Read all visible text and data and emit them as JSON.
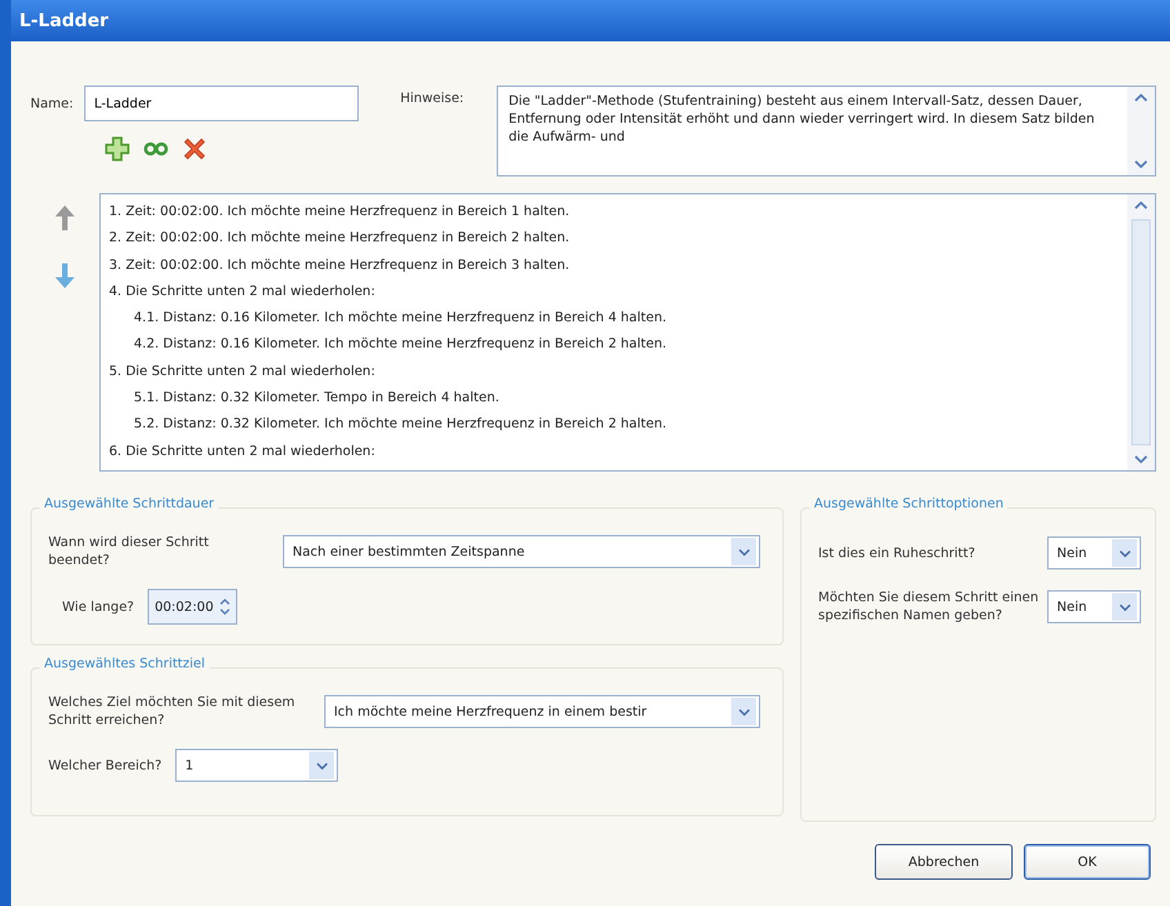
{
  "window": {
    "title": "L-Ladder"
  },
  "name": {
    "label": "Name:",
    "value": "L-Ladder"
  },
  "notes": {
    "label": "Hinweise:",
    "value": "Die \"Ladder\"-Methode (Stufentraining) besteht aus einem Intervall-Satz, dessen Dauer, Entfernung oder Intensität erhöht und dann wieder verringert wird. In diesem Satz bilden die Aufwärm- und"
  },
  "steps": [
    {
      "text": "1. Zeit: 00:02:00. Ich möchte meine Herzfrequenz in Bereich 1 halten."
    },
    {
      "text": "2. Zeit: 00:02:00. Ich möchte meine Herzfrequenz in Bereich 2 halten."
    },
    {
      "text": "3. Zeit: 00:02:00. Ich möchte meine Herzfrequenz in Bereich 3 halten."
    },
    {
      "text": "4. Die Schritte unten 2 mal wiederholen:",
      "children": [
        {
          "text": "4.1. Distanz: 0.16 Kilometer. Ich möchte meine Herzfrequenz in Bereich 4 halten."
        },
        {
          "text": "4.2. Distanz: 0.16 Kilometer. Ich möchte meine Herzfrequenz in Bereich 2 halten."
        }
      ]
    },
    {
      "text": "5. Die Schritte unten 2 mal wiederholen:",
      "children": [
        {
          "text": "5.1. Distanz: 0.32 Kilometer. Tempo in Bereich 4 halten."
        },
        {
          "text": "5.2. Distanz: 0.32 Kilometer. Ich möchte meine Herzfrequenz in Bereich 2 halten."
        }
      ]
    },
    {
      "text": "6. Die Schritte unten 2 mal wiederholen:"
    }
  ],
  "duration": {
    "title": "Ausgewählte Schrittdauer",
    "end_label": "Wann wird dieser Schritt beendet?",
    "end_value": "Nach einer bestimmten Zeitspanne",
    "length_label": "Wie lange?",
    "length_value": "00:02:00"
  },
  "target": {
    "title": "Ausgewähltes Schrittziel",
    "goal_label": "Welches Ziel möchten Sie mit diesem Schritt erreichen?",
    "goal_value": "Ich möchte meine Herzfrequenz in einem bestir",
    "zone_label": "Welcher Bereich?",
    "zone_value": "1"
  },
  "options": {
    "title": "Ausgewählte Schrittoptionen",
    "rows": [
      {
        "label": "Ist dies ein Ruheschritt?",
        "value": "Nein"
      },
      {
        "label": "Möchten Sie diesem Schritt einen spezifischen Namen geben?",
        "value": "Nein"
      }
    ]
  },
  "buttons": [
    "Abbrechen",
    "OK"
  ]
}
